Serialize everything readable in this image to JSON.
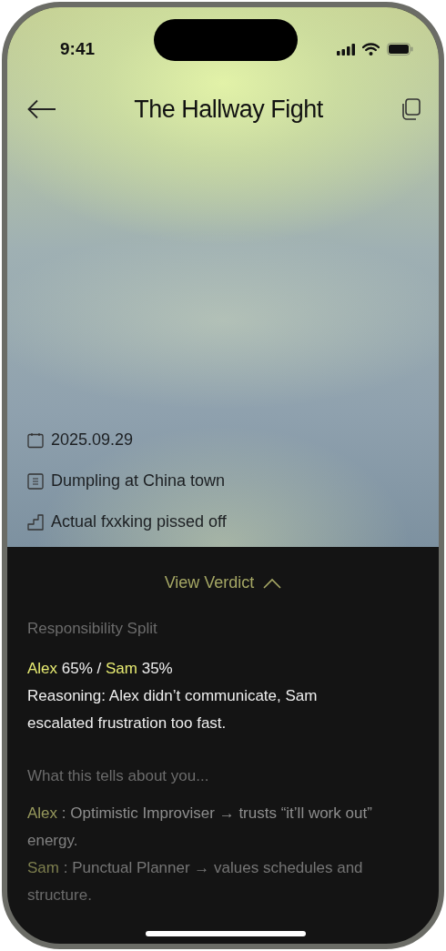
{
  "status_bar": {
    "time": "9:41"
  },
  "header": {
    "title": "The Hallway Fight"
  },
  "details": [
    {
      "kind": "date",
      "text": "2025.09.29"
    },
    {
      "kind": "note",
      "text": "Dumpling at China town"
    },
    {
      "kind": "mood",
      "text": "Actual fxxking pissed off"
    }
  ],
  "verdict": {
    "toggle": "View Verdict",
    "expanded": true,
    "split_heading": "Responsibility Split",
    "split": [
      {
        "name": "Alex",
        "share": "65%"
      },
      {
        "name": "Sam",
        "share": "35%"
      }
    ],
    "split_separator": "/",
    "reasoning": "Reasoning: Alex didn’t communicate, Sam escalated frustration too fast.",
    "traits_heading": "What this tells about you...",
    "traits": [
      {
        "name": "Alex",
        "text": ": Optimistic Improviser → trusts “it’ll work out” energy."
      },
      {
        "name": "Sam",
        "text": ": Punctual Planner → values schedules and structure."
      }
    ]
  }
}
